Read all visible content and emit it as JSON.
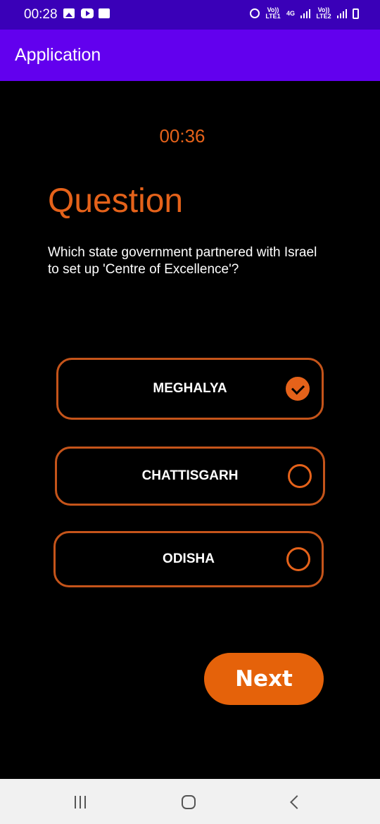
{
  "status_bar": {
    "time": "00:28",
    "network_1": "Vo)) LTE1",
    "network_type": "4G",
    "network_2": "Vo)) LTE2",
    "icons": [
      "image-icon",
      "youtube-icon",
      "wifi-icon",
      "alarm-icon",
      "signal-icon",
      "battery-icon"
    ]
  },
  "app_bar": {
    "title": "Application",
    "color": "#6200ee"
  },
  "quiz": {
    "timer": "00:36",
    "heading": "Question",
    "question": "Which state government partnered with Israel to set up 'Centre of Excellence'?",
    "options": [
      {
        "label": "MEGHALYA",
        "selected": true
      },
      {
        "label": "CHATTISGARH",
        "selected": false
      },
      {
        "label": "ODISHA",
        "selected": false
      }
    ],
    "next_label": "Next",
    "accent_color": "#e5621a"
  },
  "nav_bar": {
    "buttons": [
      "recents-icon",
      "home-icon",
      "back-icon"
    ]
  }
}
